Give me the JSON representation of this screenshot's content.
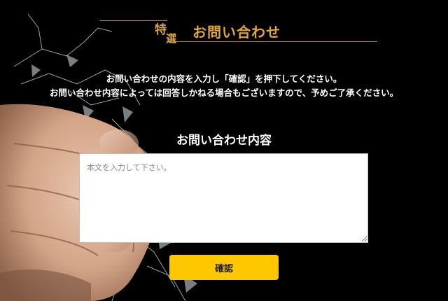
{
  "header": {
    "badge_char_1": "特",
    "badge_char_2": "選",
    "title": "お問い合わせ"
  },
  "intro": {
    "line1": "お問い合わせの内容を入力し「確認」を押下してください。",
    "line2": "お問い合わせ内容によっては回答しかねる場合もございますので、予めご了承ください。"
  },
  "form": {
    "label": "お問い合わせ内容",
    "placeholder": "本文を入力して下さい。",
    "value": "",
    "confirm_label": "確認"
  },
  "colors": {
    "background": "#000000",
    "accent_gold": "#d9a441",
    "button": "#ffc700"
  }
}
